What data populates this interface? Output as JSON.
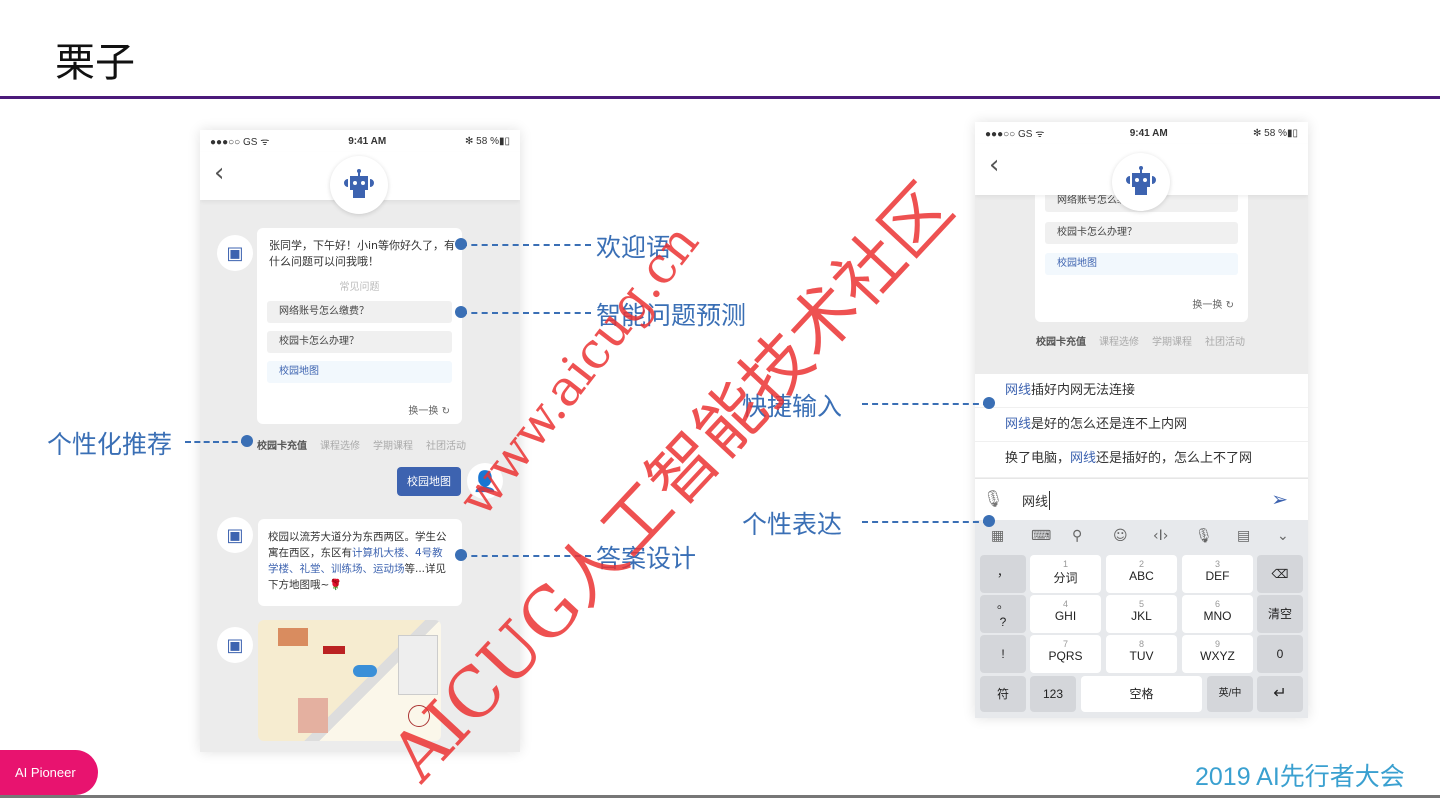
{
  "slide": {
    "title": "栗子",
    "footer_badge": "AI Pioneer",
    "footer_brand": "2019 AI先行者大会"
  },
  "watermark": {
    "line1": "www.aicug.cn",
    "line2": "AICUG人工智能技术社区"
  },
  "annotations": {
    "welcome": "欢迎语",
    "prediction": "智能问题预测",
    "recommend": "个性化推荐",
    "answer": "答案设计",
    "quick_input": "快捷输入",
    "expression": "个性表达"
  },
  "status": {
    "carrier": "●●●○○ GS ᯤ",
    "time": "9:41 AM",
    "battery": "✻ 58 %▮▯"
  },
  "left_phone": {
    "greeting": "张同学，下午好！小in等你好久了，有什么问题可以问我哦！",
    "faq_title": "常见问题",
    "questions": [
      "网络账号怎么缴费？",
      "校园卡怎么办理？",
      "校园地图"
    ],
    "refresh": "换一换",
    "tabs": [
      "校园卡充值",
      "课程选修",
      "学期课程",
      "社团活动"
    ],
    "user_msg": "校园地图",
    "answer_a": "校园以流芳大道分为东西两区。学生公寓在西区，东区有",
    "answer_links": "计算机大楼、4号教学楼、礼堂、训练场、运动场",
    "answer_b": "等...详见下方地图哦~🌹"
  },
  "right_phone": {
    "questions": [
      "网络账号怎么缴费？",
      "校园卡怎么办理？",
      "校园地图"
    ],
    "refresh": "换一换",
    "tabs": [
      "校园卡充值",
      "课程选修",
      "学期课程",
      "社团活动"
    ],
    "suggestions": [
      {
        "pre": "",
        "hl": "网线",
        "post": "插好内网无法连接"
      },
      {
        "pre": "",
        "hl": "网线",
        "post": "是好的怎么还是连不上内网"
      },
      {
        "pre": "换了电脑，",
        "hl": "网线",
        "post": "还是插好的，怎么上不了网"
      }
    ],
    "input_value": "网线",
    "keyboard": {
      "left": [
        "，",
        "。",
        "?",
        "!"
      ],
      "keys": [
        {
          "n": "1",
          "l": "分词"
        },
        {
          "n": "2",
          "l": "ABC"
        },
        {
          "n": "3",
          "l": "DEF"
        },
        {
          "n": "4",
          "l": "GHI"
        },
        {
          "n": "5",
          "l": "JKL"
        },
        {
          "n": "6",
          "l": "MNO"
        },
        {
          "n": "7",
          "l": "PQRS"
        },
        {
          "n": "8",
          "l": "TUV"
        },
        {
          "n": "9",
          "l": "WXYZ"
        }
      ],
      "clear": "清空",
      "zero": "0",
      "sym": "符",
      "num": "123",
      "space": "空格",
      "lang": "英/中",
      "backspace": "⌫",
      "enter": "↵"
    }
  }
}
